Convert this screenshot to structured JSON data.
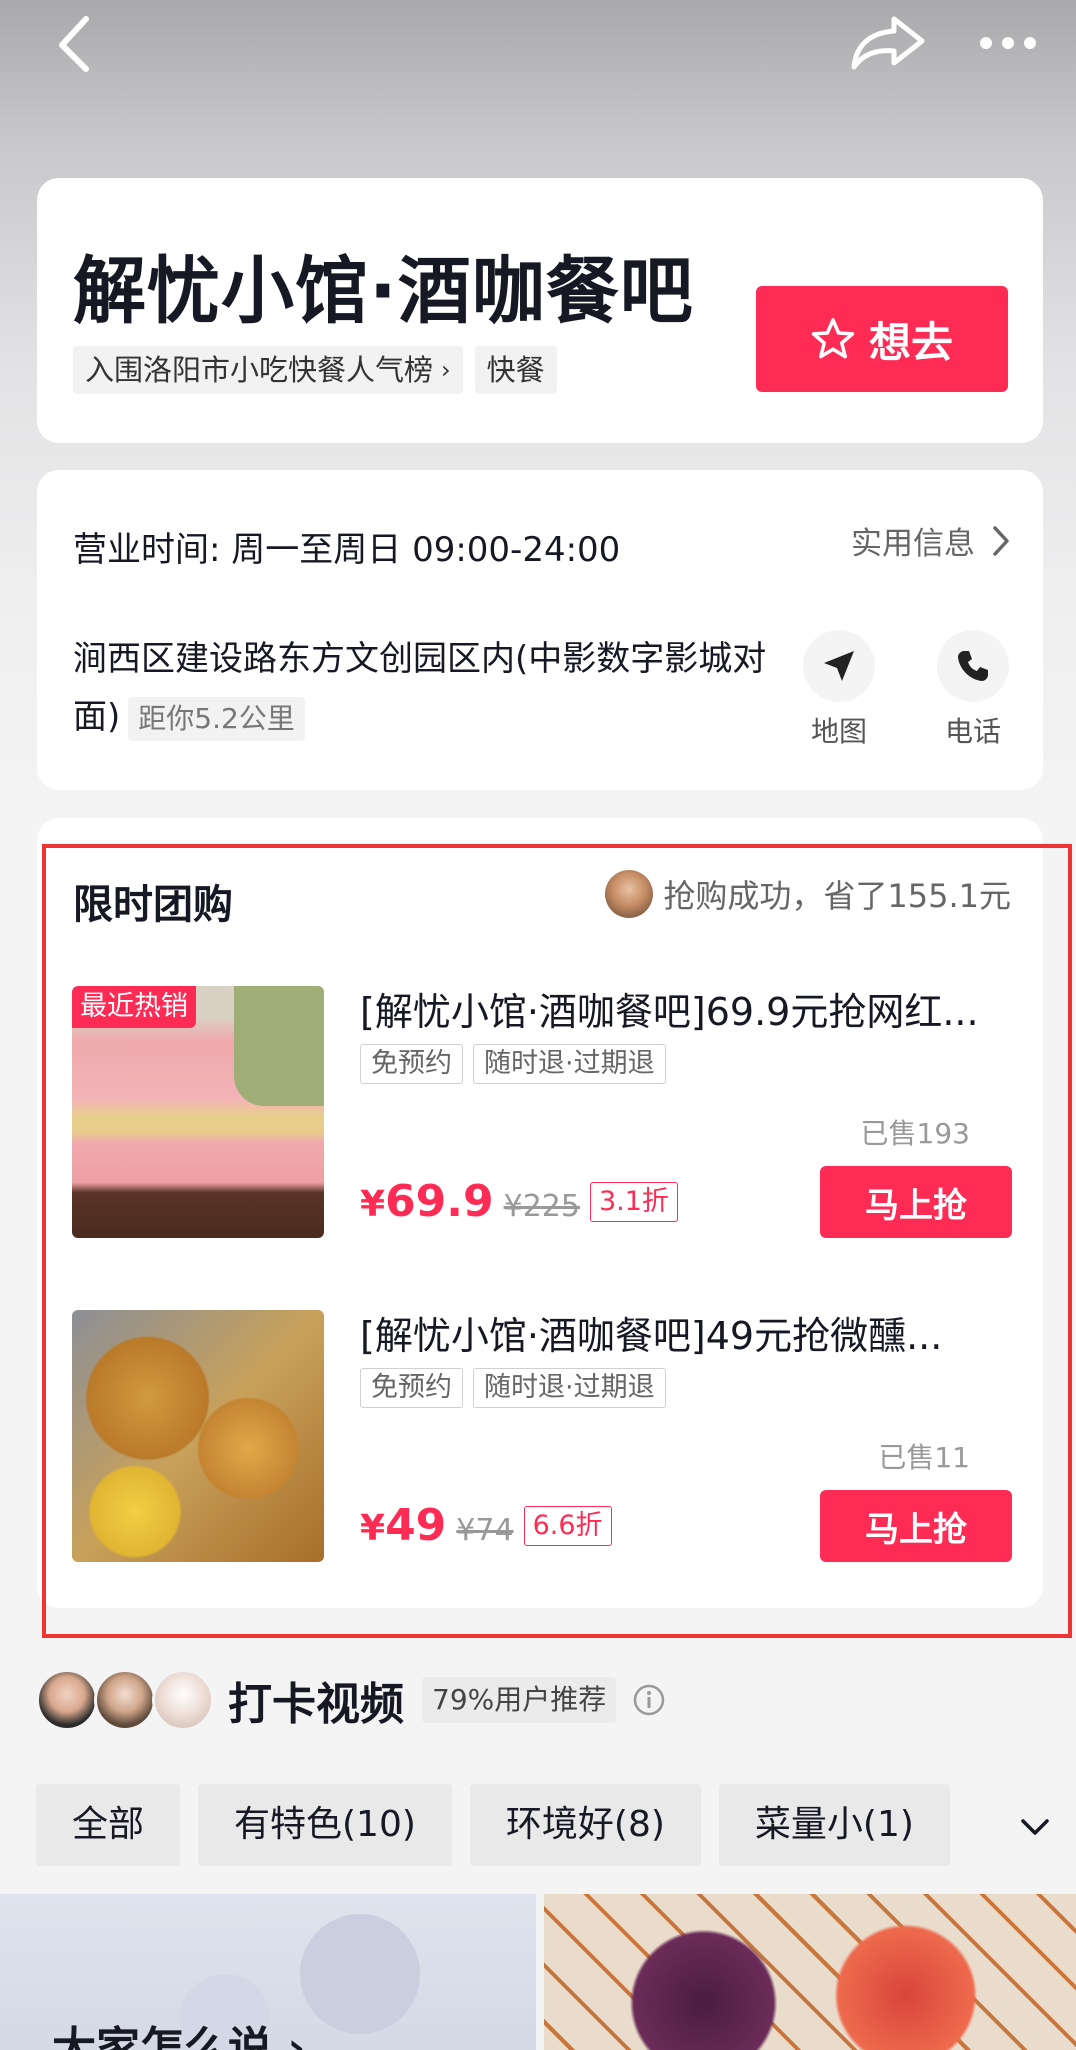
{
  "shop": {
    "name": "解忧小馆·酒咖餐吧",
    "ranking_tag": "入围洛阳市小吃快餐人气榜",
    "category_tag": "快餐",
    "want_label": "想去"
  },
  "info": {
    "hours": "营业时间: 周一至周日 09:00-24:00",
    "practical_label": "实用信息",
    "address": "涧西区建设路东方文创园区内(中影数字影城对面)",
    "distance": "距你5.2公里",
    "map_label": "地图",
    "phone_label": "电话"
  },
  "group_buy": {
    "title": "限时团购",
    "saving_text": "抢购成功，省了155.1元",
    "deals": [
      {
        "badge": "最近热销",
        "title": "[解忧小馆·酒咖餐吧]69.9元抢网红...",
        "tags": [
          "免预约",
          "随时退·过期退"
        ],
        "sold": "已售193",
        "price_symbol": "¥",
        "price": "69.9",
        "original_price": "¥225",
        "discount": "3.1折",
        "button": "马上抢"
      },
      {
        "badge": "",
        "title": "[解忧小馆·酒咖餐吧]49元抢微醺...",
        "tags": [
          "免预约",
          "随时退·过期退"
        ],
        "sold": "已售11",
        "price_symbol": "¥",
        "price": "49",
        "original_price": "¥74",
        "discount": "6.6折",
        "button": "马上抢"
      }
    ]
  },
  "checkin": {
    "title": "打卡视频",
    "recommend": "79%用户推荐"
  },
  "filters": [
    "全部",
    "有特色(10)",
    "环境好(8)",
    "菜量小(1)"
  ],
  "bottom": {
    "everyone_says": "大家怎么说 ›"
  },
  "colors": {
    "accent": "#fe2c55",
    "highlight_frame": "#f03333"
  }
}
